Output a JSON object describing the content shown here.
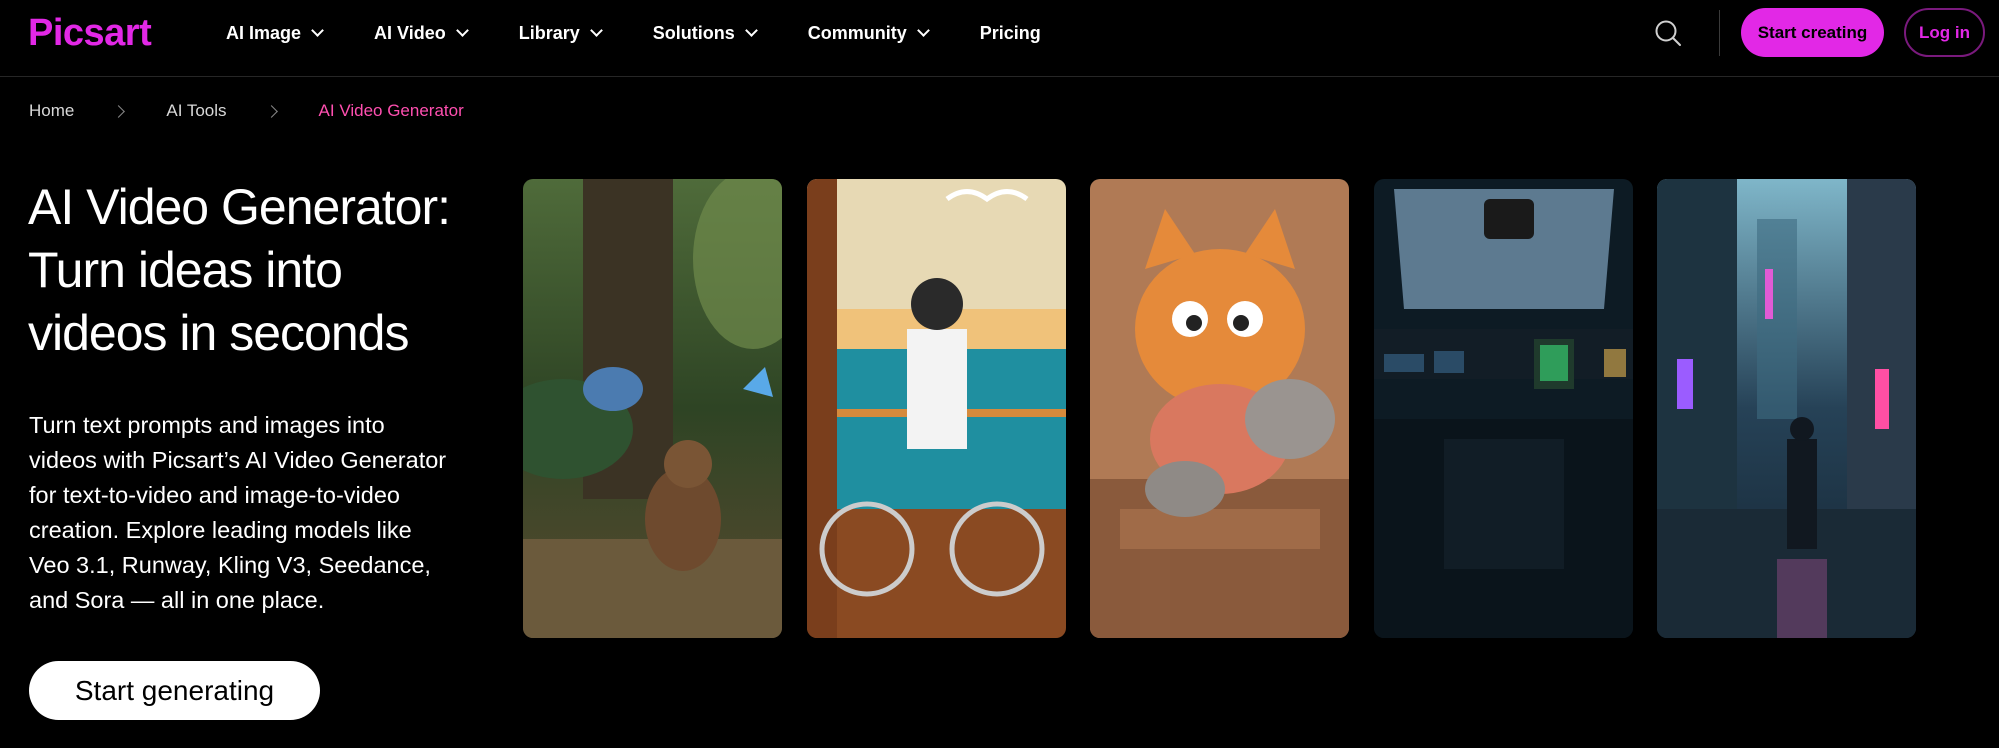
{
  "brand": {
    "logo_text": "Picsart",
    "accent": "#e228e6",
    "breadcrumb_active": "#ff4fb0"
  },
  "nav": {
    "items": [
      {
        "label": "AI Image",
        "has_dropdown": true
      },
      {
        "label": "AI Video",
        "has_dropdown": true
      },
      {
        "label": "Library",
        "has_dropdown": true
      },
      {
        "label": "Solutions",
        "has_dropdown": true
      },
      {
        "label": "Community",
        "has_dropdown": true
      },
      {
        "label": "Pricing",
        "has_dropdown": false
      }
    ],
    "start_creating": "Start creating",
    "login": "Log in"
  },
  "breadcrumb": [
    "Home",
    "AI Tools",
    "AI Video Generator"
  ],
  "hero": {
    "title_lines": [
      "AI Video Generator:",
      "Turn ideas into",
      "videos in seconds"
    ],
    "description_lines": [
      "Turn text prompts and images into",
      "videos with Picsart’s AI Video Generator",
      "for text-to-video and image-to-video",
      "creation. Explore leading models like",
      "Veo 3.1, Runway, Kling V3, Seedance,",
      "and Sora — all in one place."
    ],
    "cta": "Start generating"
  },
  "icons": {
    "search": "search-icon",
    "chevron": "chevron-down-icon",
    "separator": "chevron-right-icon"
  }
}
